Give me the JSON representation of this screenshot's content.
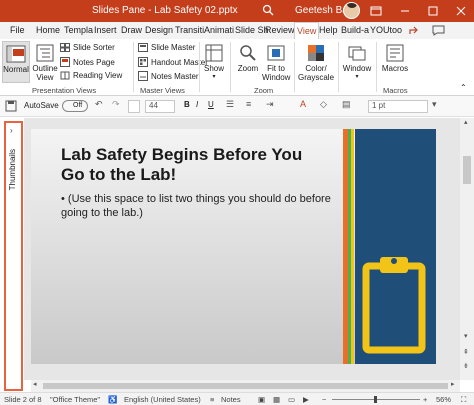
{
  "window": {
    "title": "Slides Pane - Lab Safety 02.pptx",
    "user": "Geetesh Bajaj"
  },
  "tabs": [
    "File",
    "Home",
    "Templa",
    "Insert",
    "Draw",
    "Design",
    "Transiti",
    "Animati",
    "Slide Sh",
    "Review",
    "View",
    "Help",
    "Build-a",
    "YOUtoo"
  ],
  "active_tab": "View",
  "ribbon": {
    "normal": "Normal",
    "outline_view": "Outline View",
    "slide_sorter": "Slide Sorter",
    "notes_page": "Notes Page",
    "reading_view": "Reading View",
    "presentation_views_label": "Presentation Views",
    "slide_master": "Slide Master",
    "handout_master": "Handout Master",
    "notes_master": "Notes Master",
    "master_views_label": "Master Views",
    "show": "Show",
    "zoom": "Zoom",
    "fit_to_window": "Fit to Window",
    "zoom_label": "Zoom",
    "color_grayscale": "Color/ Grayscale",
    "window": "Window",
    "macros": "Macros",
    "macros_label": "Macros"
  },
  "qat": {
    "autosave": "AutoSave",
    "autosave_state": "Off",
    "font_size": "44",
    "line_spacing": "1 pt"
  },
  "thumbnails_label": "Thumbnails",
  "slide": {
    "title": "Lab Safety Begins Before You Go to the Lab!",
    "bullet": "(Use this space to list two things you should do before going to the lab.)"
  },
  "status": {
    "slide": "Slide 2 of 8",
    "theme": "\"Office Theme\"",
    "language": "English (United States)",
    "notes": "Notes",
    "zoom": "56%"
  },
  "colors": {
    "accent": "#c43e1c",
    "slide_panel": "#1f4e79",
    "clipboard": "#f2c417",
    "stripe_orange": "#e8702a",
    "stripe_green": "#4caf50",
    "stripe_yellow": "#f2c417"
  }
}
